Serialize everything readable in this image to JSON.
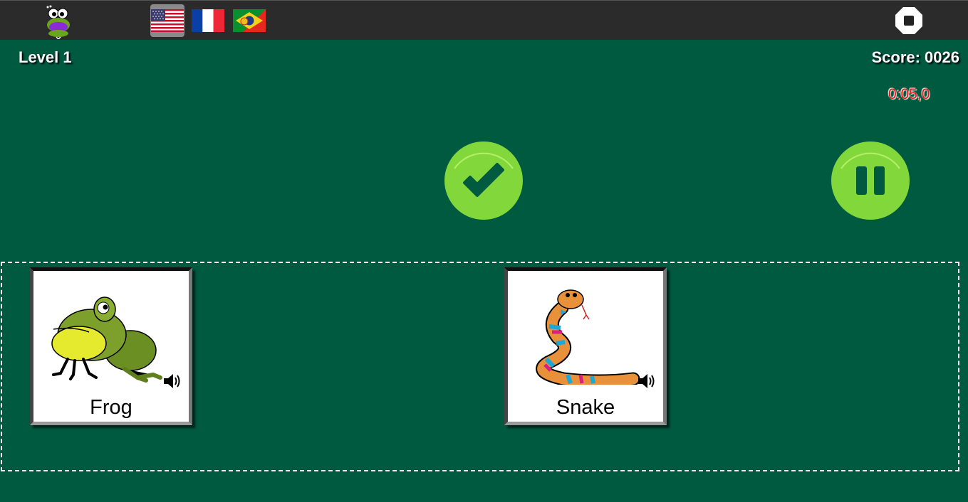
{
  "header": {
    "languages": [
      {
        "name": "English (US)",
        "active": true
      },
      {
        "name": "French",
        "active": false
      },
      {
        "name": "Portuguese (Brazil)",
        "active": false
      }
    ]
  },
  "hud": {
    "level_label": "Level  1",
    "score_label": "Score:  0026",
    "timer": "0:05,0"
  },
  "controls": {
    "check_icon": "check-icon",
    "pause_icon": "pause-icon",
    "stop_icon": "stop-icon"
  },
  "cards": [
    {
      "word": "Frog",
      "image": "frog-picture",
      "sound_icon": "speaker-icon"
    },
    {
      "word": "Snake",
      "image": "snake-picture",
      "sound_icon": "speaker-icon"
    }
  ],
  "colors": {
    "background": "#005a40",
    "topbar": "#2b2b2b",
    "button_green": "#82d83a",
    "timer_red": "#e11111"
  }
}
